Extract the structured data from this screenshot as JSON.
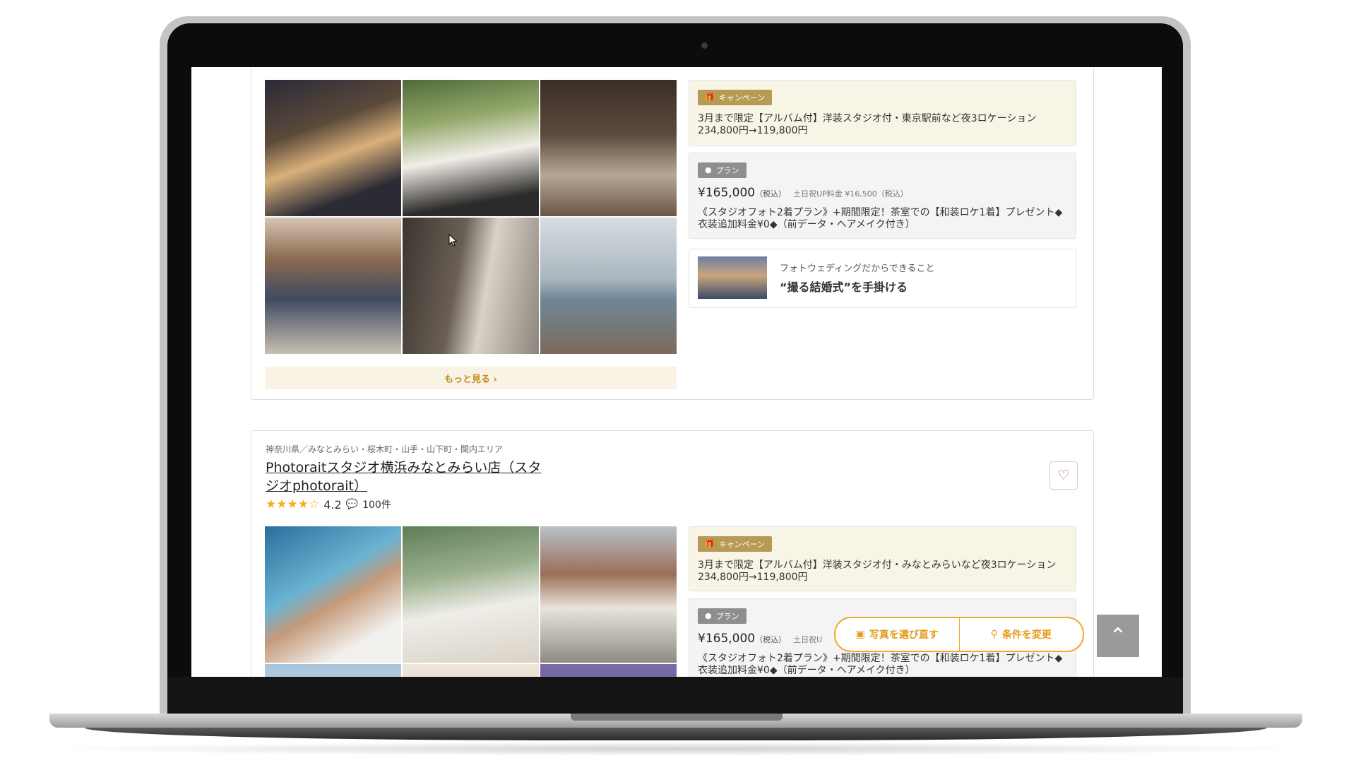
{
  "listing1": {
    "more_label": "もっと見る ›",
    "campaign": {
      "tag": "キャンペーン",
      "text": "3月まで限定【アルバム付】洋装スタジオ付・東京駅前など夜3ロケーション234,800円→119,800円"
    },
    "plan": {
      "tag": "プラン",
      "price": "¥165,000",
      "tax": "（税込）",
      "weekend_note": "土日祝UP料金 ¥16,500（税込）",
      "text": "《スタジオフォト2着プラン》+期間限定！茶室での【和装ロケ1着】プレゼント◆衣装追加料金¥0◆（前データ・ヘアメイク付き）"
    },
    "feature": {
      "subtitle": "フォトウェディングだからできること",
      "title": "“撮る結婚式”を手掛ける"
    }
  },
  "listing2": {
    "area": "神奈川県／みなとみらい・桜木町・山手・山下町・関内エリア",
    "name": "Photoraitスタジオ横浜みなとみらい店（スタジオphotorait）",
    "stars": "★★★★☆",
    "rating": "4.2",
    "reviews": "100件",
    "campaign": {
      "tag": "キャンペーン",
      "text": "3月まで限定【アルバム付】洋装スタジオ付・みなとみらいなど夜3ロケーション234,800円→119,800円"
    },
    "plan": {
      "tag": "プラン",
      "price": "¥165,000",
      "tax": "（税込）",
      "weekend_note": "土日祝U",
      "text": "《スタジオフォト2着プラン》+期間限定！茶室での【和装ロケ1着】プレゼント◆衣装追加料金¥0◆（前データ・ヘアメイク付き）"
    }
  },
  "floating": {
    "reselect_label": "写真を選び直す",
    "change_label": "条件を変更"
  },
  "icons": {
    "gift": "gift-icon",
    "plan": "plan-icon",
    "heart": "heart-icon",
    "search": "search-icon",
    "photo": "photo-icon",
    "chat": "chat-icon",
    "up": "chevron-up-icon"
  },
  "colors": {
    "accent_orange": "#f0a92a",
    "campaign_bg": "#f8f5e6",
    "campaign_tag": "#b59b53",
    "star": "#f2b01e",
    "heart": "#d1455b"
  }
}
